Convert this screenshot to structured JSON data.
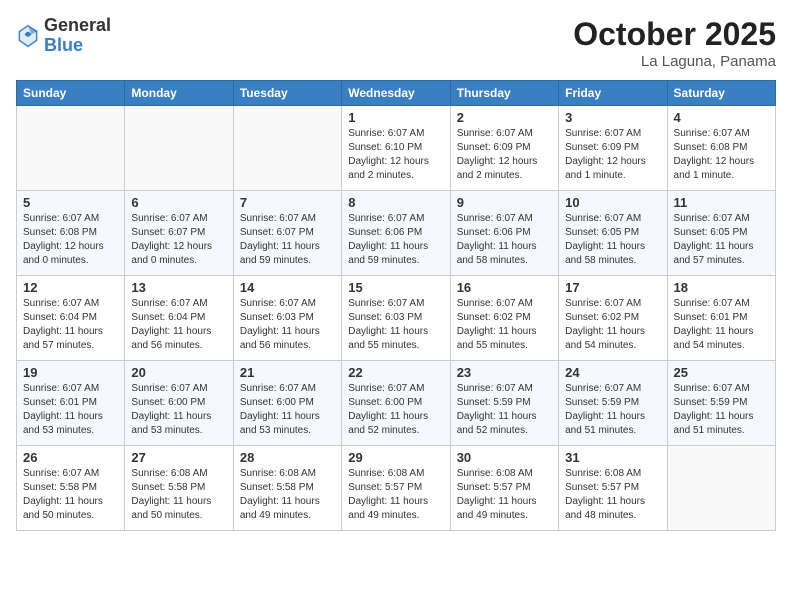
{
  "header": {
    "logo_general": "General",
    "logo_blue": "Blue",
    "month": "October 2025",
    "location": "La Laguna, Panama"
  },
  "weekdays": [
    "Sunday",
    "Monday",
    "Tuesday",
    "Wednesday",
    "Thursday",
    "Friday",
    "Saturday"
  ],
  "weeks": [
    [
      {
        "day": "",
        "info": ""
      },
      {
        "day": "",
        "info": ""
      },
      {
        "day": "",
        "info": ""
      },
      {
        "day": "1",
        "info": "Sunrise: 6:07 AM\nSunset: 6:10 PM\nDaylight: 12 hours\nand 2 minutes."
      },
      {
        "day": "2",
        "info": "Sunrise: 6:07 AM\nSunset: 6:09 PM\nDaylight: 12 hours\nand 2 minutes."
      },
      {
        "day": "3",
        "info": "Sunrise: 6:07 AM\nSunset: 6:09 PM\nDaylight: 12 hours\nand 1 minute."
      },
      {
        "day": "4",
        "info": "Sunrise: 6:07 AM\nSunset: 6:08 PM\nDaylight: 12 hours\nand 1 minute."
      }
    ],
    [
      {
        "day": "5",
        "info": "Sunrise: 6:07 AM\nSunset: 6:08 PM\nDaylight: 12 hours\nand 0 minutes."
      },
      {
        "day": "6",
        "info": "Sunrise: 6:07 AM\nSunset: 6:07 PM\nDaylight: 12 hours\nand 0 minutes."
      },
      {
        "day": "7",
        "info": "Sunrise: 6:07 AM\nSunset: 6:07 PM\nDaylight: 11 hours\nand 59 minutes."
      },
      {
        "day": "8",
        "info": "Sunrise: 6:07 AM\nSunset: 6:06 PM\nDaylight: 11 hours\nand 59 minutes."
      },
      {
        "day": "9",
        "info": "Sunrise: 6:07 AM\nSunset: 6:06 PM\nDaylight: 11 hours\nand 58 minutes."
      },
      {
        "day": "10",
        "info": "Sunrise: 6:07 AM\nSunset: 6:05 PM\nDaylight: 11 hours\nand 58 minutes."
      },
      {
        "day": "11",
        "info": "Sunrise: 6:07 AM\nSunset: 6:05 PM\nDaylight: 11 hours\nand 57 minutes."
      }
    ],
    [
      {
        "day": "12",
        "info": "Sunrise: 6:07 AM\nSunset: 6:04 PM\nDaylight: 11 hours\nand 57 minutes."
      },
      {
        "day": "13",
        "info": "Sunrise: 6:07 AM\nSunset: 6:04 PM\nDaylight: 11 hours\nand 56 minutes."
      },
      {
        "day": "14",
        "info": "Sunrise: 6:07 AM\nSunset: 6:03 PM\nDaylight: 11 hours\nand 56 minutes."
      },
      {
        "day": "15",
        "info": "Sunrise: 6:07 AM\nSunset: 6:03 PM\nDaylight: 11 hours\nand 55 minutes."
      },
      {
        "day": "16",
        "info": "Sunrise: 6:07 AM\nSunset: 6:02 PM\nDaylight: 11 hours\nand 55 minutes."
      },
      {
        "day": "17",
        "info": "Sunrise: 6:07 AM\nSunset: 6:02 PM\nDaylight: 11 hours\nand 54 minutes."
      },
      {
        "day": "18",
        "info": "Sunrise: 6:07 AM\nSunset: 6:01 PM\nDaylight: 11 hours\nand 54 minutes."
      }
    ],
    [
      {
        "day": "19",
        "info": "Sunrise: 6:07 AM\nSunset: 6:01 PM\nDaylight: 11 hours\nand 53 minutes."
      },
      {
        "day": "20",
        "info": "Sunrise: 6:07 AM\nSunset: 6:00 PM\nDaylight: 11 hours\nand 53 minutes."
      },
      {
        "day": "21",
        "info": "Sunrise: 6:07 AM\nSunset: 6:00 PM\nDaylight: 11 hours\nand 53 minutes."
      },
      {
        "day": "22",
        "info": "Sunrise: 6:07 AM\nSunset: 6:00 PM\nDaylight: 11 hours\nand 52 minutes."
      },
      {
        "day": "23",
        "info": "Sunrise: 6:07 AM\nSunset: 5:59 PM\nDaylight: 11 hours\nand 52 minutes."
      },
      {
        "day": "24",
        "info": "Sunrise: 6:07 AM\nSunset: 5:59 PM\nDaylight: 11 hours\nand 51 minutes."
      },
      {
        "day": "25",
        "info": "Sunrise: 6:07 AM\nSunset: 5:59 PM\nDaylight: 11 hours\nand 51 minutes."
      }
    ],
    [
      {
        "day": "26",
        "info": "Sunrise: 6:07 AM\nSunset: 5:58 PM\nDaylight: 11 hours\nand 50 minutes."
      },
      {
        "day": "27",
        "info": "Sunrise: 6:08 AM\nSunset: 5:58 PM\nDaylight: 11 hours\nand 50 minutes."
      },
      {
        "day": "28",
        "info": "Sunrise: 6:08 AM\nSunset: 5:58 PM\nDaylight: 11 hours\nand 49 minutes."
      },
      {
        "day": "29",
        "info": "Sunrise: 6:08 AM\nSunset: 5:57 PM\nDaylight: 11 hours\nand 49 minutes."
      },
      {
        "day": "30",
        "info": "Sunrise: 6:08 AM\nSunset: 5:57 PM\nDaylight: 11 hours\nand 49 minutes."
      },
      {
        "day": "31",
        "info": "Sunrise: 6:08 AM\nSunset: 5:57 PM\nDaylight: 11 hours\nand 48 minutes."
      },
      {
        "day": "",
        "info": ""
      }
    ]
  ]
}
